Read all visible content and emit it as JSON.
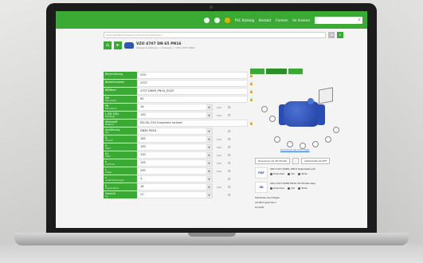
{
  "topbar": {
    "links": [
      "PSC Katalog",
      "Kontakt",
      "Formen",
      "Im Inneren"
    ],
    "search_placeholder": ""
  },
  "pathbar": {
    "value": "/Fast-Data/Bibliothek/Armaturen/Ventile/Kugel/..."
  },
  "header": {
    "title": "VZO 4707 DN 65 PN16",
    "subtitle": "Absperrarmaturen > Schieber > VZO 4707 DN65"
  },
  "table": {
    "rows": [
      {
        "label": "Beschreibung",
        "sub": "",
        "value": "VZO",
        "dropdown": false,
        "unit": ""
      },
      {
        "label": "Bestellnummer",
        "sub": "",
        "value": "4707",
        "dropdown": false,
        "unit": ""
      },
      {
        "label": "NB/Nenn",
        "sub": "",
        "value": "4707-DN65_PN16_GG25",
        "dropdown": false,
        "unit": ""
      },
      {
        "label": "DN",
        "sub": "Nennweite",
        "value": "65",
        "dropdown": false,
        "unit": ""
      },
      {
        "label": "PN",
        "sub": "Nenndruck",
        "value": "16",
        "dropdown": true,
        "unit": "mm"
      },
      {
        "label": "L (EN 558)",
        "sub": "Baulänge",
        "value": "190",
        "dropdown": true,
        "unit": "mm"
      },
      {
        "label": "Werkstoff",
        "sub": "Material",
        "value": "EN-GJL-250 Gusseisen lackiert",
        "dropdown": false,
        "unit": ""
      },
      {
        "label": "Ausführung",
        "sub": "Typ",
        "value": "DN65 PN16",
        "dropdown": true,
        "unit": ""
      },
      {
        "label": "D",
        "sub": "Flansch",
        "value": "185",
        "dropdown": true,
        "unit": "mm"
      },
      {
        "label": "H",
        "sub": "Höhe",
        "value": "190",
        "dropdown": true,
        "unit": "mm"
      },
      {
        "label": "H1",
        "sub": "Höhe",
        "value": "130",
        "dropdown": true,
        "unit": "mm"
      },
      {
        "label": "k",
        "sub": "Lochkreis",
        "value": "145",
        "dropdown": true,
        "unit": "mm"
      },
      {
        "label": "L",
        "sub": "Länge",
        "value": "290",
        "dropdown": true,
        "unit": "mm"
      },
      {
        "label": "n",
        "sub": "Anzahl Bohrungen",
        "value": "4",
        "dropdown": true,
        "unit": ""
      },
      {
        "label": "b",
        "sub": "Flanschdicke",
        "value": "18",
        "dropdown": true,
        "unit": "mm"
      },
      {
        "label": "Gewicht",
        "sub": "kg",
        "value": "21",
        "dropdown": true,
        "unit": ""
      }
    ]
  },
  "right": {
    "tabs": [
      "3D",
      "Ansicht",
      "2D"
    ],
    "viewer_link": "Download als CAD Datei",
    "download_label": "Download als 3D-Modell",
    "datasheet_label": "Datenblatt als PDF",
    "files": [
      {
        "thumb": "PDF",
        "name": "VZO 4707 DN65_PN16 Datenblatt.pdf",
        "actions": [
          "Download",
          "Info",
          "Teilen"
        ]
      },
      {
        "thumb": "3D",
        "name": "VZO 4707 DN65 PN16 3D Modell.step",
        "actions": [
          "Download",
          "Info",
          "Teilen"
        ]
      }
    ],
    "bottom_links": [
      "Merkliste hinzufügen",
      "Als Bild speichern",
      "Kontakt"
    ]
  }
}
